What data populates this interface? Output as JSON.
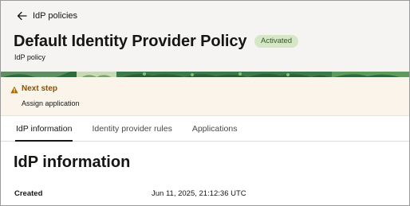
{
  "header": {
    "back_label": "IdP policies",
    "title": "Default Identity Provider Policy",
    "status_badge": "Activated",
    "subtitle": "IdP policy"
  },
  "banner": {
    "icon": "warning-icon",
    "title": "Next step",
    "text": "Assign application"
  },
  "tabs": [
    {
      "label": "IdP information",
      "active": true
    },
    {
      "label": "Identity provider rules",
      "active": false
    },
    {
      "label": "Applications",
      "active": false
    }
  ],
  "section": {
    "title": "IdP information",
    "fields": [
      {
        "label": "Created",
        "value": "Jun 11, 2025, 21:12:36 UTC"
      }
    ]
  },
  "colors": {
    "badge_bg": "#d5e7c6",
    "badge_text": "#2f5a23",
    "banner_bg": "#fbf4ea",
    "banner_title": "#8a5200",
    "header_art_green": "#3d7a4a"
  }
}
